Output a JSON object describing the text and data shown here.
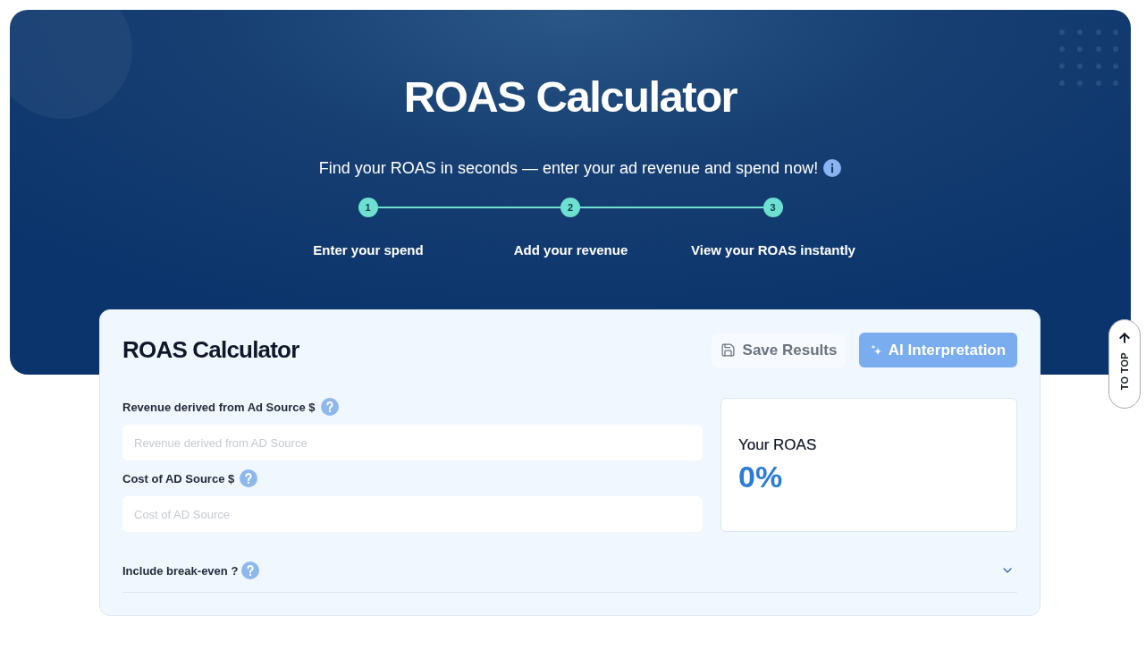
{
  "hero": {
    "title": "ROAS Calculator",
    "subtitle": "Find your ROAS in seconds — enter your ad revenue and spend now!",
    "steps": [
      {
        "number": "1",
        "label": "Enter your spend"
      },
      {
        "number": "2",
        "label": "Add your revenue"
      },
      {
        "number": "3",
        "label": "View your ROAS instantly"
      }
    ]
  },
  "calculator": {
    "title": "ROAS Calculator",
    "actions": [
      {
        "kind": "save",
        "label": "Save Results",
        "disabled": true
      },
      {
        "kind": "ai",
        "label": "AI Interpretation",
        "disabled": true
      }
    ],
    "fields": [
      {
        "label": "Revenue derived from Ad Source $",
        "placeholder": "Revenue derived from AD Source"
      },
      {
        "label": "Cost of AD Source $",
        "placeholder": "Cost of AD Source"
      }
    ],
    "result": {
      "label": "Your ROAS",
      "value": "0%"
    },
    "break_even": {
      "label": "Include break-even ?",
      "expanded": false
    }
  },
  "to_top": {
    "label": "TO TOP"
  }
}
